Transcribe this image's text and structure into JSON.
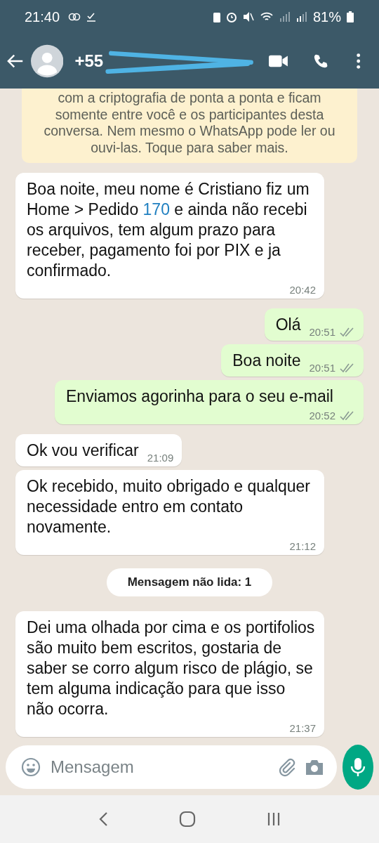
{
  "status_bar": {
    "time": "21:40",
    "battery": "81%"
  },
  "header": {
    "contact": "+55"
  },
  "encryption_notice": "com a criptografia de ponta a ponta e ficam somente entre você e os participantes desta conversa. Nem mesmo o WhatsApp pode ler ou ouvi-las. Toque para saber mais.",
  "messages": [
    {
      "kind": "in",
      "parts": [
        {
          "text": "Boa noite, meu nome é Cristiano fiz um Home > Pedido "
        },
        {
          "text": "170",
          "kind": "link"
        },
        {
          "text": " e ainda não recebi os arquivos, tem algum prazo para receber, pagamento foi por PIX e ja confirmado."
        }
      ],
      "time": "20:42"
    },
    {
      "kind": "out",
      "parts": [
        {
          "text": "Olá"
        }
      ],
      "time": "20:51",
      "read": false
    },
    {
      "kind": "out",
      "parts": [
        {
          "text": "Boa noite"
        }
      ],
      "time": "20:51",
      "read": false
    },
    {
      "kind": "out",
      "parts": [
        {
          "text": "Enviamos agorinha para o seu e-mail"
        }
      ],
      "time": "20:52",
      "read": false
    },
    {
      "kind": "in",
      "parts": [
        {
          "text": "Ok vou verificar"
        }
      ],
      "time": "21:09"
    },
    {
      "kind": "in",
      "parts": [
        {
          "text": "Ok recebido, muito obrigado e qualquer necessidade entro em contato novamente."
        }
      ],
      "time": "21:12"
    },
    {
      "kind": "divider",
      "label": "Mensagem não lida: 1"
    },
    {
      "kind": "in",
      "parts": [
        {
          "text": "Dei uma olhada por cima e os portifolios são muito bem escritos, gostaria de saber se corro algum risco de plágio, se tem alguma indicação para que isso não ocorra."
        }
      ],
      "time": "21:37"
    }
  ],
  "composer": {
    "placeholder": "Mensagem"
  }
}
